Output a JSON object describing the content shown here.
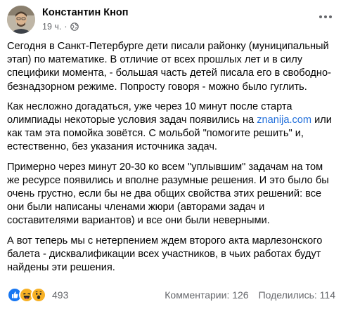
{
  "header": {
    "author_name": "Константин Кноп",
    "time": "19 ч.",
    "separator": "·",
    "privacy_icon": "globe-icon",
    "more_icon": "more-options-icon"
  },
  "post": {
    "p1": "Сегодня в Санкт-Петербурге дети писали районку (муниципальный этап) по математике.  В отличие от всех прошлых лет и в силу специфики момента, - большая часть детей писала его в свободно-безнадзорном режиме. Попросту говоря - можно было гуглить.",
    "p2_before": "Как несложно догадаться, уже через 10 минут после старта олимпиады некоторые условия задач появились на ",
    "p2_link": "znanija.com",
    "p2_after": " или как там эта помойка зовётся. С мольбой \"помогите решить\" и, естественно, без указания источника задач.",
    "p3": "Примерно через минут 20-30 ко всем \"уплывшим\" задачам на том же ресурсе появились и вполне разумные решения. И это было бы очень грустно, если бы не два общих свойства этих решений: все они были написаны членами жюри (авторами задач и составителями вариантов)  и все они были неверными.",
    "p4": "А вот теперь мы с нетерпением ждем второго акта марлезонского балета - дисквалификации всех участников, в чьих работах будут найдены эти решения."
  },
  "footer": {
    "reaction_icons": [
      "like-reaction-icon",
      "haha-reaction-icon",
      "wow-reaction-icon"
    ],
    "reaction_count": "493",
    "comments": "Комментарии: 126",
    "shares": "Поделились: 114"
  },
  "colors": {
    "text": "#050505",
    "secondary": "#65676b",
    "link": "#216fdb",
    "like_blue": "#1877f2",
    "reaction_yellow": "#f7b125"
  }
}
